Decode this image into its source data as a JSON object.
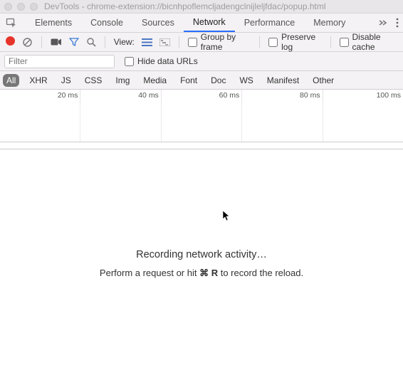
{
  "window": {
    "title": "DevTools - chrome-extension://bicnhpoflemcljadengclnijleljfdac/popup.html"
  },
  "tabs": {
    "items": [
      "Elements",
      "Console",
      "Sources",
      "Network",
      "Performance",
      "Memory"
    ],
    "active": "Network"
  },
  "toolbar": {
    "view_label": "View:",
    "group_by_frame": "Group by frame",
    "preserve_log": "Preserve log",
    "disable_cache": "Disable cache"
  },
  "filter": {
    "placeholder": "Filter",
    "hide_data_urls": "Hide data URLs"
  },
  "types": [
    "All",
    "XHR",
    "JS",
    "CSS",
    "Img",
    "Media",
    "Font",
    "Doc",
    "WS",
    "Manifest",
    "Other"
  ],
  "timeline": {
    "ticks": [
      "20 ms",
      "40 ms",
      "60 ms",
      "80 ms",
      "100 ms"
    ]
  },
  "messages": {
    "recording": "Recording network activity…",
    "hint_pre": "Perform a request or hit ",
    "hint_k1": "⌘",
    "hint_k2": "R",
    "hint_post": " to record the reload."
  }
}
